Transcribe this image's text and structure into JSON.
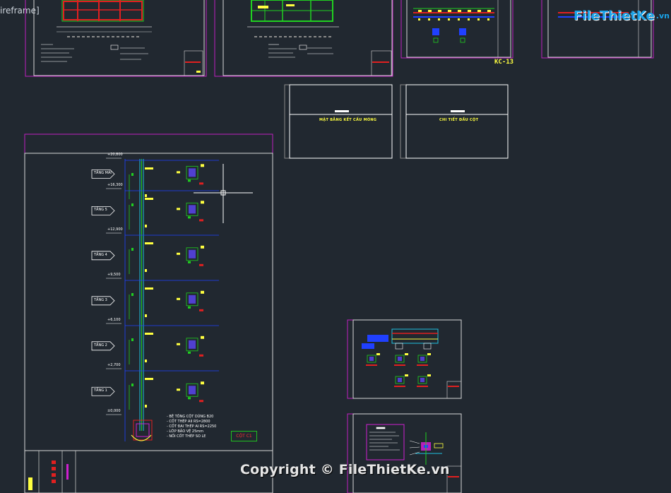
{
  "viewport": {
    "view_label": "ireframe]",
    "background": "#212830"
  },
  "watermark": {
    "text": "Copyright © FileThietKe.vn"
  },
  "logo": {
    "brand": "FileThietKe",
    "suffix": ".vn"
  },
  "sheets": {
    "kc13_label": "KC-13",
    "section1_title": "MẶT BẰNG KẾT CẤU MÓNG",
    "section2_title": "CHI TIẾT ĐẦU CỘT",
    "cot_tag": "CỘT C1"
  },
  "column_detail": {
    "level_marks": [
      "+20,800",
      "+16,300",
      "+12,900",
      "+9,500",
      "+6,100",
      "+2,700",
      "±0,000"
    ],
    "floor_tags": [
      "TẦNG MÁI",
      "TẦNG 5",
      "TẦNG 4",
      "TẦNG 3",
      "TẦNG 2",
      "TẦNG 1"
    ],
    "notes": [
      "- BÊ TÔNG CỘT DÙNG B20",
      "- CỐT THÉP AII RS=2800",
      "- CỐT ĐAI THÉP AI RS=2250",
      "- LỚP BẢO VỆ 25mm",
      "- NỐI CỐT THÉP SO LE"
    ]
  },
  "colors": {
    "sheet_border": "#d8d8d8",
    "magenta_frame": "#c020c0",
    "green_line": "#20d020",
    "red_line": "#e02020",
    "yellow_text": "#ffff40",
    "cyan_line": "#20c0e0",
    "blue_fill": "#2040ff"
  }
}
